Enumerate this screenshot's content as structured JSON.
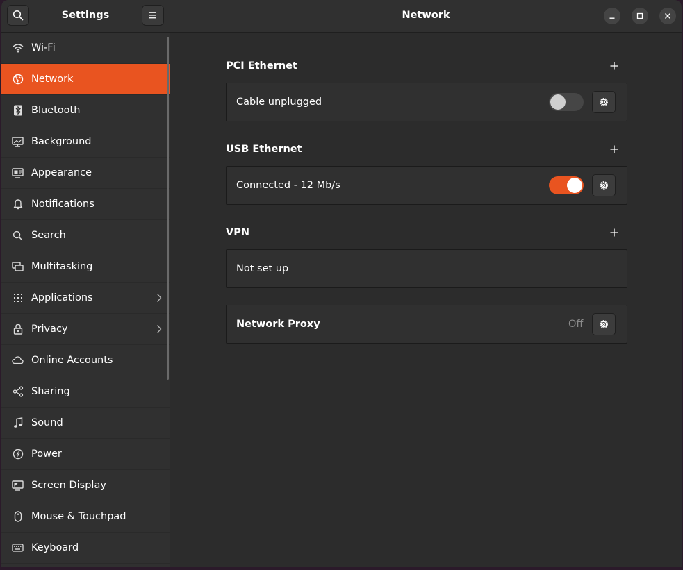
{
  "sidebar": {
    "title": "Settings",
    "items": [
      {
        "label": "Wi-Fi",
        "icon": "wifi-icon"
      },
      {
        "label": "Network",
        "icon": "globe-icon",
        "active": true
      },
      {
        "label": "Bluetooth",
        "icon": "bluetooth-icon"
      },
      {
        "label": "Background",
        "icon": "background-icon"
      },
      {
        "label": "Appearance",
        "icon": "appearance-icon"
      },
      {
        "label": "Notifications",
        "icon": "bell-icon"
      },
      {
        "label": "Search",
        "icon": "search-icon"
      },
      {
        "label": "Multitasking",
        "icon": "multitasking-icon"
      },
      {
        "label": "Applications",
        "icon": "grid-icon",
        "chevron": true
      },
      {
        "label": "Privacy",
        "icon": "lock-icon",
        "chevron": true
      },
      {
        "label": "Online Accounts",
        "icon": "cloud-icon"
      },
      {
        "label": "Sharing",
        "icon": "share-icon"
      },
      {
        "label": "Sound",
        "icon": "music-note-icon"
      },
      {
        "label": "Power",
        "icon": "power-icon"
      },
      {
        "label": "Screen Display",
        "icon": "display-icon"
      },
      {
        "label": "Mouse & Touchpad",
        "icon": "mouse-icon"
      },
      {
        "label": "Keyboard",
        "icon": "keyboard-icon"
      }
    ]
  },
  "main": {
    "title": "Network",
    "sections": {
      "pci": {
        "title": "PCI Ethernet",
        "status": "Cable unplugged",
        "enabled": false
      },
      "usb": {
        "title": "USB Ethernet",
        "status": "Connected - 12 Mb/s",
        "enabled": true
      },
      "vpn": {
        "title": "VPN",
        "status": "Not set up"
      },
      "proxy": {
        "label": "Network Proxy",
        "value": "Off"
      }
    }
  },
  "colors": {
    "accent": "#e95420",
    "window_bg": "#2c2c2c",
    "sidebar_bg": "#303030"
  }
}
